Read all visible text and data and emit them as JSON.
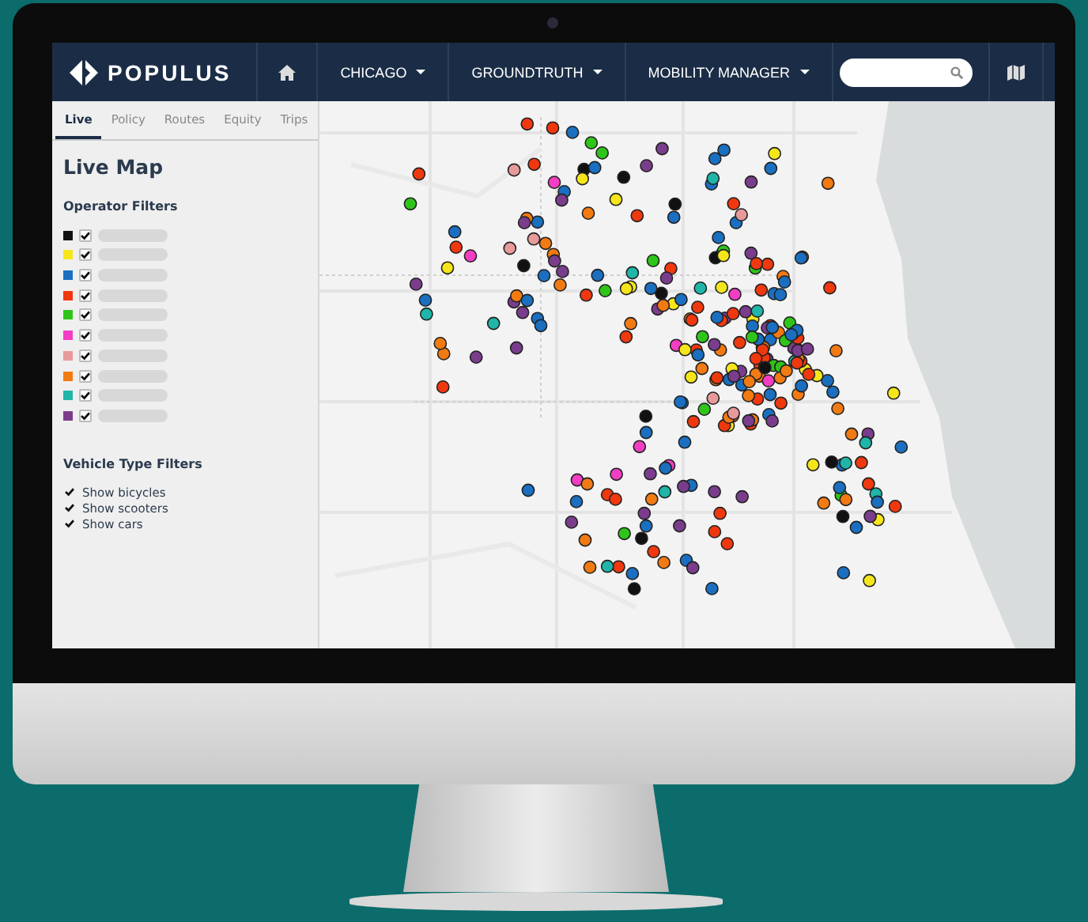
{
  "brand": {
    "name": "POPULUS"
  },
  "nav": {
    "items": [
      {
        "label": "CHICAGO"
      },
      {
        "label": "GROUNDTRUTH"
      },
      {
        "label": "MOBILITY MANAGER"
      }
    ]
  },
  "tabs": [
    {
      "label": "Live",
      "selected": true
    },
    {
      "label": "Policy",
      "selected": false
    },
    {
      "label": "Routes",
      "selected": false
    },
    {
      "label": "Equity",
      "selected": false
    },
    {
      "label": "Trips",
      "selected": false
    }
  ],
  "sidebar": {
    "title": "Live Map",
    "operator_heading": "Operator Filters",
    "operators": [
      {
        "color": "#111111",
        "checked": true
      },
      {
        "color": "#f5e61c",
        "checked": true
      },
      {
        "color": "#1a6fc0",
        "checked": true
      },
      {
        "color": "#f0380f",
        "checked": true
      },
      {
        "color": "#2fc41a",
        "checked": true
      },
      {
        "color": "#f23ec2",
        "checked": true
      },
      {
        "color": "#e89a9a",
        "checked": true
      },
      {
        "color": "#f27a12",
        "checked": true
      },
      {
        "color": "#1fb5a8",
        "checked": true
      },
      {
        "color": "#7a3d8c",
        "checked": true
      }
    ],
    "vehicle_heading": "Vehicle Type Filters",
    "vehicle_filters": [
      {
        "label": "Show bicycles",
        "checked": true
      },
      {
        "label": "Show scooters",
        "checked": true
      },
      {
        "label": "Show cars",
        "checked": true
      }
    ]
  }
}
